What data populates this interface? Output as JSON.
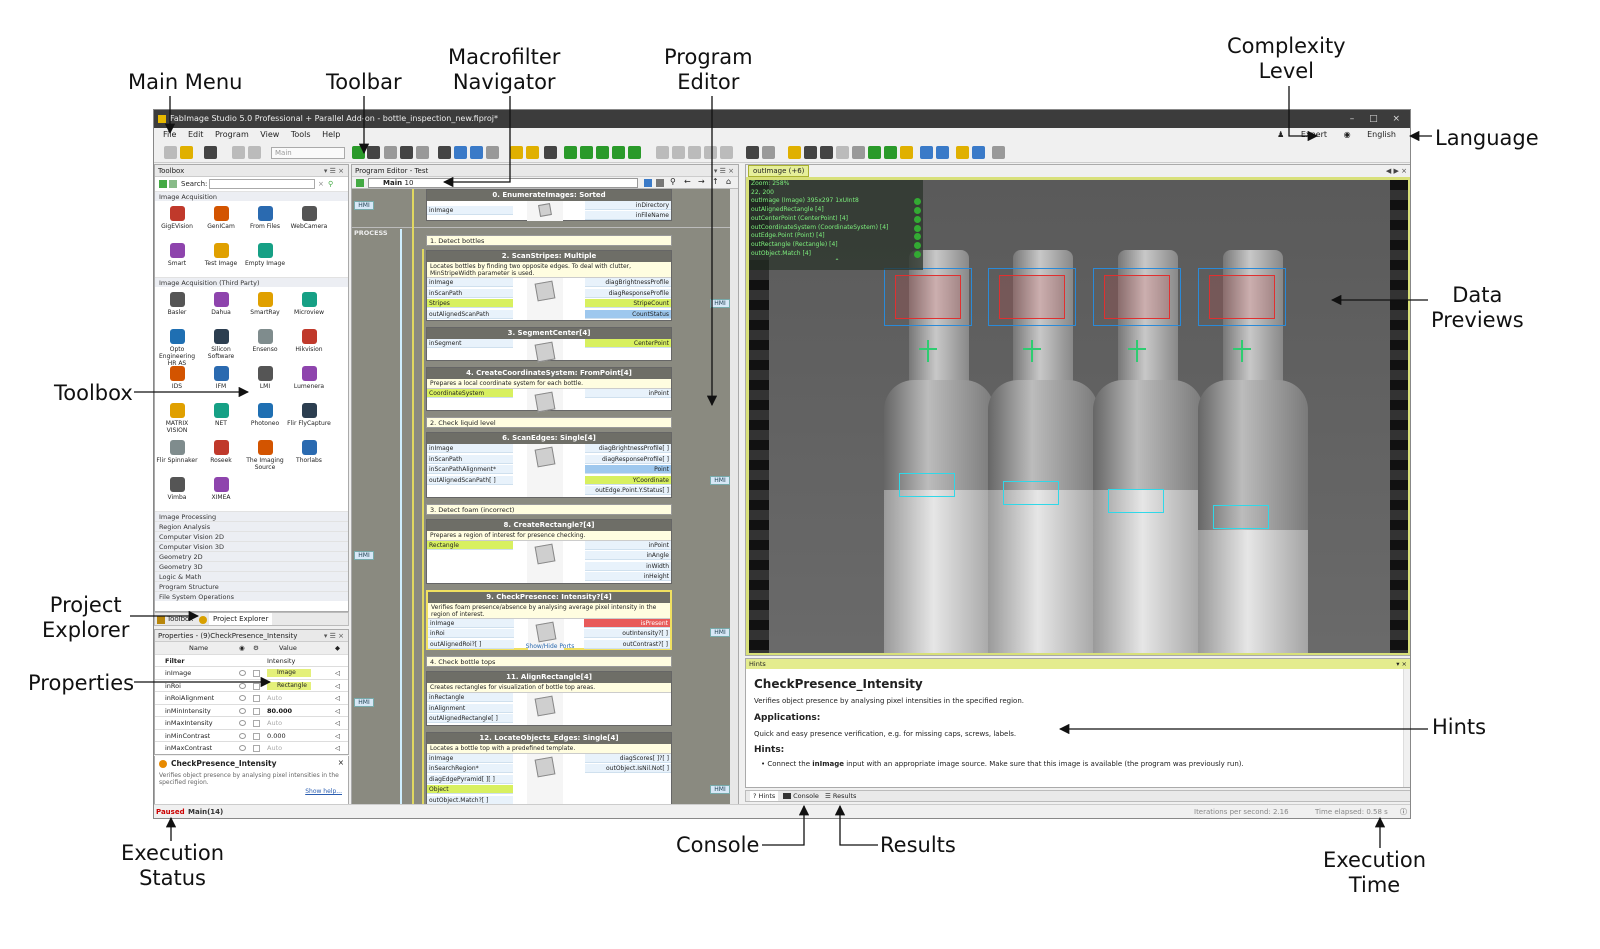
{
  "callouts": {
    "main_menu": "Main Menu",
    "toolbar": "Toolbar",
    "macrofilter_navigator": [
      "Macrofilter",
      "Navigator"
    ],
    "program_editor": [
      "Program",
      "Editor"
    ],
    "complexity_level": [
      "Complexity",
      "Level"
    ],
    "language": "Language",
    "data_previews": [
      "Data",
      "Previews"
    ],
    "toolbox": "Toolbox",
    "project_explorer": [
      "Project",
      "Explorer"
    ],
    "properties": "Properties",
    "hints": "Hints",
    "console": "Console",
    "results": "Results",
    "execution_status": [
      "Execution",
      "Status"
    ],
    "execution_time": [
      "Execution",
      "Time"
    ]
  },
  "window": {
    "title": "FabImage Studio 5.0 Professional + Parallel Add-on - bottle_inspection_new.fiproj*",
    "controls": "–  □  ×"
  },
  "menu": {
    "items": [
      "File",
      "Edit",
      "Program",
      "View",
      "Tools",
      "Help"
    ],
    "complexity": "Expert",
    "language": "English"
  },
  "toolbar": {
    "macrofilter_select": "Main"
  },
  "toolbox": {
    "title": "Toolbox",
    "search_label": "Search:",
    "categories": [
      {
        "name": "Image Acquisition",
        "tools": [
          "GigEVision",
          "GenICam",
          "From Files",
          "WebCamera",
          "Smart",
          "Test Image",
          "Empty Image"
        ]
      },
      {
        "name": "Image Acquisition (Third Party)",
        "tools": [
          "Basler",
          "Dahua",
          "SmartRay",
          "Microview",
          "Opto Engineering HR AS",
          "Silicon Software",
          "Ensenso",
          "Hikvision",
          "IDS",
          "IFM",
          "LMI",
          "Lumenera",
          "MATRIX VISION",
          "NET",
          "Photoneo",
          "Flir FlyCapture",
          "Flir Spinnaker",
          "Roseek",
          "The Imaging Source",
          "Thorlabs",
          "Vimba",
          "XIMEA"
        ]
      }
    ],
    "collapsed": [
      "Image Processing",
      "Region Analysis",
      "Computer Vision 2D",
      "Computer Vision 3D",
      "Geometry 2D",
      "Geometry 3D",
      "Logic & Math",
      "Program Structure",
      "File System Operations"
    ],
    "tabs": [
      "Toolbox",
      "Project Explorer"
    ]
  },
  "properties": {
    "title": "Properties - (9)CheckPresence_Intensity",
    "cols": [
      "Name",
      "Value"
    ],
    "filter_label": "Filter",
    "filter_value": "Intensity",
    "rows": [
      {
        "name": "inImage",
        "value": "Image"
      },
      {
        "name": "inRoi",
        "value": "Rectangle"
      },
      {
        "name": "inRoiAlignment",
        "value": "Auto"
      },
      {
        "name": "inMinIntensity",
        "value": "80.000"
      },
      {
        "name": "inMaxIntensity",
        "value": "Auto"
      },
      {
        "name": "inMinContrast",
        "value": "0.000"
      },
      {
        "name": "inMaxContrast",
        "value": "Auto"
      }
    ],
    "tip_title": "CheckPresence_Intensity",
    "tip_text": "Verifies object presence by analysing pixel intensities in the specified region.",
    "tip_link": "Show help..."
  },
  "editor": {
    "title": "Program Editor - Test",
    "nav_main": "Main",
    "nav_count": "10",
    "process_label": "PROCESS",
    "hmi": "HMI",
    "top_block": {
      "name": "0. EnumerateImages: Sorted",
      "in": "inImage",
      "outs": [
        "inDirectory",
        "inFileName"
      ]
    },
    "blocks": [
      {
        "comment": "1. Detect bottles"
      },
      {
        "name": "2. ScanStripes: Multiple",
        "desc": "Locates bottles by finding two opposite edges. To deal with clutter, MinStripeWidth parameter is used.",
        "ins": [
          "inImage",
          "inScanPath",
          "Stripes",
          "outAlignedScanPath"
        ],
        "outs": [
          "diagBrightnessProfile",
          "diagResponseProfile",
          "StripeCount",
          "CountStatus"
        ]
      },
      {
        "name": "3. SegmentCenter[4]",
        "ins": [
          "inSegment"
        ],
        "outs": [
          "CenterPoint"
        ]
      },
      {
        "name": "4. CreateCoordinateSystem: FromPoint[4]",
        "desc": "Prepares a local coordinate system for each bottle.",
        "ins": [
          "CoordinateSystem"
        ],
        "outs": [
          "inPoint"
        ]
      },
      {
        "comment": "2. Check liquid level"
      },
      {
        "name": "6. ScanEdges: Single[4]",
        "ins": [
          "inImage",
          "inScanPath",
          "inScanPathAlignment*",
          "outAlignedScanPath[ ]"
        ],
        "outs": [
          "diagBrightnessProfile[ ]",
          "diagResponseProfile[ ]",
          "Point",
          "YCoordinate",
          "outEdge.Point.Y.Status[ ]"
        ]
      },
      {
        "comment": "3. Detect foam (incorrect)"
      },
      {
        "name": "8. CreateRectangle?[4]",
        "desc": "Prepares a region of interest for presence checking.",
        "ins": [
          "Rectangle"
        ],
        "outs": [
          "inPoint",
          "inAngle",
          "inWidth",
          "inHeight"
        ]
      },
      {
        "name": "9. CheckPresence: Intensity?[4]",
        "desc": "Verifies foam presence/absence by analysing average pixel intensity in the region of interest.",
        "ins": [
          "inImage",
          "inRoi",
          "outAlignedRoi?[ ]"
        ],
        "outs": [
          "isPresent",
          "outIntensity?[ ]",
          "outContrast?[ ]"
        ],
        "extra": "Show/Hide Ports"
      },
      {
        "comment": "4. Check bottle tops"
      },
      {
        "name": "11. AlignRectangle[4]",
        "desc": "Creates rectangles for visualization of bottle top areas.",
        "ins": [
          "inRectangle",
          "inAlignment",
          "outAlignedRectangle[ ]"
        ],
        "outs": []
      },
      {
        "name": "12. LocateObjects_Edges: Single[4]",
        "desc": "Locates a bottle top with a predefined template.",
        "ins": [
          "inImage",
          "inSearchRegion*",
          "diagEdgePyramid[ ][ ]",
          "Object",
          "outObject.Match?[ ]"
        ],
        "outs": [
          "diagScores[ ]?[ ]",
          "outObject.IsNil.Not[ ]"
        ]
      }
    ]
  },
  "preview": {
    "tab": "outImage (+6)",
    "zoom": "Zoom: 258%",
    "coords": "22, 200",
    "layers": [
      "outImage (Image) 395x297 1xUInt8",
      "outAlignedRectangle [4]",
      "outCenterPoint (CenterPoint) [4]",
      "outCoordinateSystem (CoordinateSystem) [4]",
      "outEdge.Point (Point) [4]",
      "outRectangle (Rectangle) [4]",
      "outObject.Match [4]"
    ]
  },
  "hints": {
    "title": "Hints",
    "heading": "CheckPresence_Intensity",
    "summary": "Verifies object presence by analysing pixel intensities in the specified region.",
    "applications_label": "Applications:",
    "applications": "Quick and easy presence verification, e.g. for missing caps, screws, labels.",
    "hints_label": "Hints:",
    "hint_pre": "Connect the ",
    "hint_bold": "inImage",
    "hint_post": " input with an appropriate image source. Make sure that this image is available (the program was previously run).",
    "tabs": [
      "Hints",
      "Console",
      "Results"
    ]
  },
  "status": {
    "state": "Paused",
    "macro": "Main(14)",
    "iterations": "Iterations per second: 2.16",
    "elapsed": "Time elapsed: 0.58 s"
  }
}
